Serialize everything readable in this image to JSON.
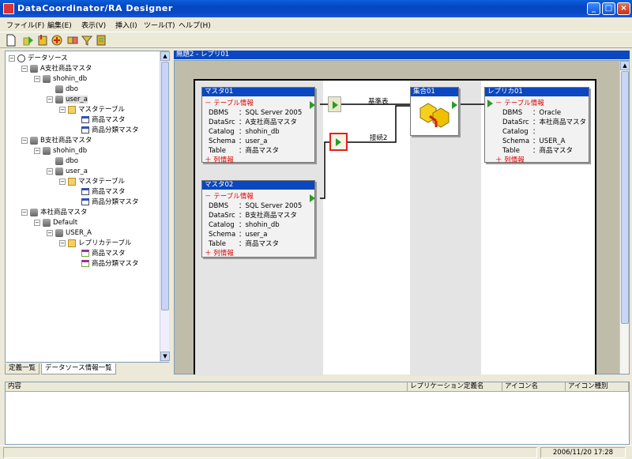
{
  "window": {
    "title": "DataCoordinator/RA Designer",
    "minimize": "_",
    "maximize": "□",
    "close": "×"
  },
  "menu": [
    "ファイル(F)",
    "編集(E)",
    "表示(V)",
    "挿入(I)",
    "ツール(T)",
    "ヘルプ(H)"
  ],
  "tree": {
    "root": "データソース",
    "nodes": [
      {
        "label": "A支社商品マスタ"
      },
      {
        "label": "shohin_db"
      },
      {
        "label": "dbo"
      },
      {
        "label": "user_a"
      },
      {
        "label": "マスタテーブル"
      },
      {
        "label": "商品マスタ"
      },
      {
        "label": "商品分類マスタ"
      },
      {
        "label": "B支社商品マスタ"
      },
      {
        "label": "shohin_db"
      },
      {
        "label": "dbo"
      },
      {
        "label": "user_a"
      },
      {
        "label": "マスタテーブル"
      },
      {
        "label": "商品マスタ"
      },
      {
        "label": "商品分類マスタ"
      },
      {
        "label": "本社商品マスタ"
      },
      {
        "label": "Default"
      },
      {
        "label": "USER_A"
      },
      {
        "label": "レプリカテーブル"
      },
      {
        "label": "商品マスタ"
      },
      {
        "label": "商品分類マスタ"
      }
    ]
  },
  "left_tabs": [
    "定義一覧",
    "データソース情報一覧"
  ],
  "document": {
    "title": "無題2 - レプリ01"
  },
  "nodes": {
    "master1": {
      "title": "マスタ01",
      "section": "－ テーブル情報",
      "rows": [
        {
          "k": "DBMS",
          "v": "：SQL Server 2005"
        },
        {
          "k": "DataSrc",
          "v": "：A支社商品マスタ"
        },
        {
          "k": "Catalog",
          "v": "：shohin_db"
        },
        {
          "k": "Schema",
          "v": "：user_a"
        },
        {
          "k": "Table",
          "v": "：商品マスタ"
        }
      ],
      "footer": "＋ 列情報"
    },
    "master2": {
      "title": "マスタ02",
      "section": "－ テーブル情報",
      "rows": [
        {
          "k": "DBMS",
          "v": "：SQL Server 2005"
        },
        {
          "k": "DataSrc",
          "v": "：B支社商品マスタ"
        },
        {
          "k": "Catalog",
          "v": "：shohin_db"
        },
        {
          "k": "Schema",
          "v": "：user_a"
        },
        {
          "k": "Table",
          "v": "：商品マスタ"
        }
      ],
      "footer": "＋ 列情報"
    },
    "union": {
      "title": "集合01"
    },
    "replica": {
      "title": "レプリカ01",
      "section": "－ テーブル情報",
      "rows": [
        {
          "k": "DBMS",
          "v": "：Oracle"
        },
        {
          "k": "DataSrc",
          "v": "：本社商品マスタ"
        },
        {
          "k": "Catalog",
          "v": "："
        },
        {
          "k": "Schema",
          "v": "：USER_A"
        },
        {
          "k": "Table",
          "v": "：商品マスタ"
        }
      ],
      "footer": "＋ 列情報"
    },
    "link_base": "基準表",
    "link_join": "接続2"
  },
  "bottom_columns": [
    "内容",
    "レプリケーション定義名",
    "アイコン名",
    "アイコン種別"
  ],
  "status": {
    "datetime": "2006/11/20 17:28"
  }
}
